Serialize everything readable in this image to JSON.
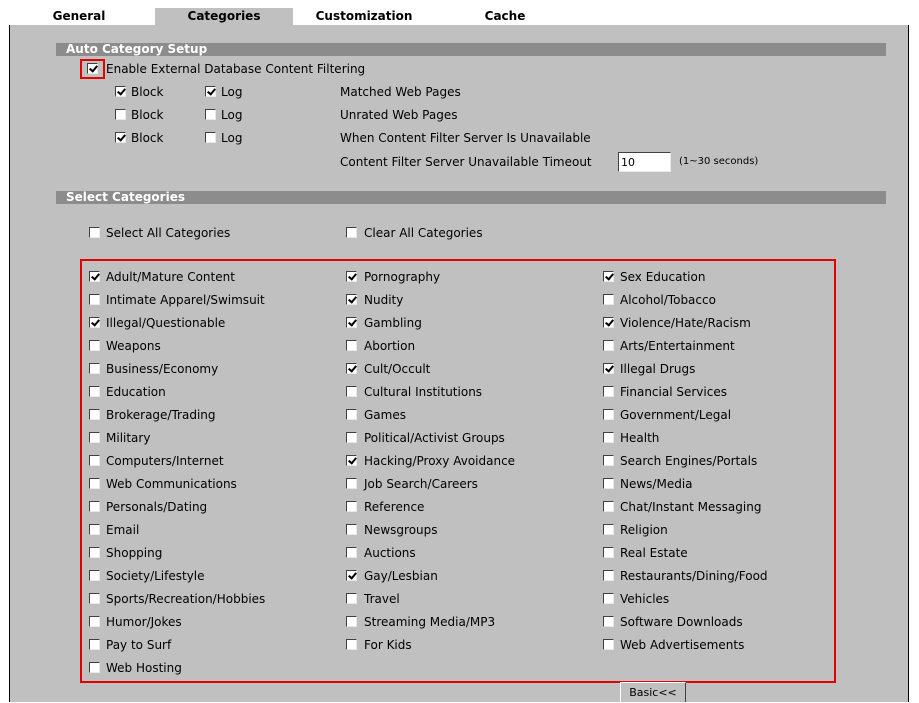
{
  "tabs": [
    {
      "label": "General",
      "active": false
    },
    {
      "label": "Categories",
      "active": true
    },
    {
      "label": "Customization",
      "active": false
    },
    {
      "label": "Cache",
      "active": false
    }
  ],
  "auto_setup": {
    "title": "Auto Category Setup",
    "enable_label": "Enable External Database Content Filtering",
    "enable_checked": true,
    "block_label": "Block",
    "log_label": "Log",
    "rows": [
      {
        "block": true,
        "log": true,
        "desc": "Matched Web Pages"
      },
      {
        "block": false,
        "log": false,
        "desc": "Unrated Web Pages"
      },
      {
        "block": true,
        "log": false,
        "desc": "When Content Filter Server Is Unavailable"
      }
    ],
    "timeout_label": "Content Filter Server Unavailable Timeout",
    "timeout_value": "10",
    "timeout_hint": "(1~30 seconds)"
  },
  "select_categories": {
    "title": "Select Categories",
    "select_all_label": "Select All Categories",
    "clear_all_label": "Clear All Categories",
    "columns": [
      [
        {
          "label": "Adult/Mature Content",
          "checked": true
        },
        {
          "label": "Intimate Apparel/Swimsuit",
          "checked": false
        },
        {
          "label": "Illegal/Questionable",
          "checked": true
        },
        {
          "label": "Weapons",
          "checked": false
        },
        {
          "label": "Business/Economy",
          "checked": false
        },
        {
          "label": "Education",
          "checked": false
        },
        {
          "label": "Brokerage/Trading",
          "checked": false
        },
        {
          "label": "Military",
          "checked": false
        },
        {
          "label": "Computers/Internet",
          "checked": false
        },
        {
          "label": "Web Communications",
          "checked": false
        },
        {
          "label": "Personals/Dating",
          "checked": false
        },
        {
          "label": "Email",
          "checked": false
        },
        {
          "label": "Shopping",
          "checked": false
        },
        {
          "label": "Society/Lifestyle",
          "checked": false
        },
        {
          "label": "Sports/Recreation/Hobbies",
          "checked": false
        },
        {
          "label": "Humor/Jokes",
          "checked": false
        },
        {
          "label": "Pay to Surf",
          "checked": false
        },
        {
          "label": "Web Hosting",
          "checked": false
        }
      ],
      [
        {
          "label": "Pornography",
          "checked": true
        },
        {
          "label": "Nudity",
          "checked": true
        },
        {
          "label": "Gambling",
          "checked": true
        },
        {
          "label": "Abortion",
          "checked": false
        },
        {
          "label": "Cult/Occult",
          "checked": true
        },
        {
          "label": "Cultural Institutions",
          "checked": false
        },
        {
          "label": "Games",
          "checked": false
        },
        {
          "label": "Political/Activist Groups",
          "checked": false
        },
        {
          "label": "Hacking/Proxy Avoidance",
          "checked": true
        },
        {
          "label": "Job Search/Careers",
          "checked": false
        },
        {
          "label": "Reference",
          "checked": false
        },
        {
          "label": "Newsgroups",
          "checked": false
        },
        {
          "label": "Auctions",
          "checked": false
        },
        {
          "label": "Gay/Lesbian",
          "checked": true
        },
        {
          "label": "Travel",
          "checked": false
        },
        {
          "label": "Streaming Media/MP3",
          "checked": false
        },
        {
          "label": "For Kids",
          "checked": false
        }
      ],
      [
        {
          "label": "Sex Education",
          "checked": true
        },
        {
          "label": "Alcohol/Tobacco",
          "checked": false
        },
        {
          "label": "Violence/Hate/Racism",
          "checked": true
        },
        {
          "label": "Arts/Entertainment",
          "checked": false
        },
        {
          "label": "Illegal Drugs",
          "checked": true
        },
        {
          "label": "Financial Services",
          "checked": false
        },
        {
          "label": "Government/Legal",
          "checked": false
        },
        {
          "label": "Health",
          "checked": false
        },
        {
          "label": "Search Engines/Portals",
          "checked": false
        },
        {
          "label": "News/Media",
          "checked": false
        },
        {
          "label": "Chat/Instant Messaging",
          "checked": false
        },
        {
          "label": "Religion",
          "checked": false
        },
        {
          "label": "Real Estate",
          "checked": false
        },
        {
          "label": "Restaurants/Dining/Food",
          "checked": false
        },
        {
          "label": "Vehicles",
          "checked": false
        },
        {
          "label": "Software Downloads",
          "checked": false
        },
        {
          "label": "Web Advertisements",
          "checked": false
        }
      ]
    ]
  },
  "basic_button_label": "Basic<<",
  "colors": {
    "panel_bg": "#c0c0c0",
    "section_bar": "#8c8c8c",
    "highlight_border": "#e00000"
  }
}
